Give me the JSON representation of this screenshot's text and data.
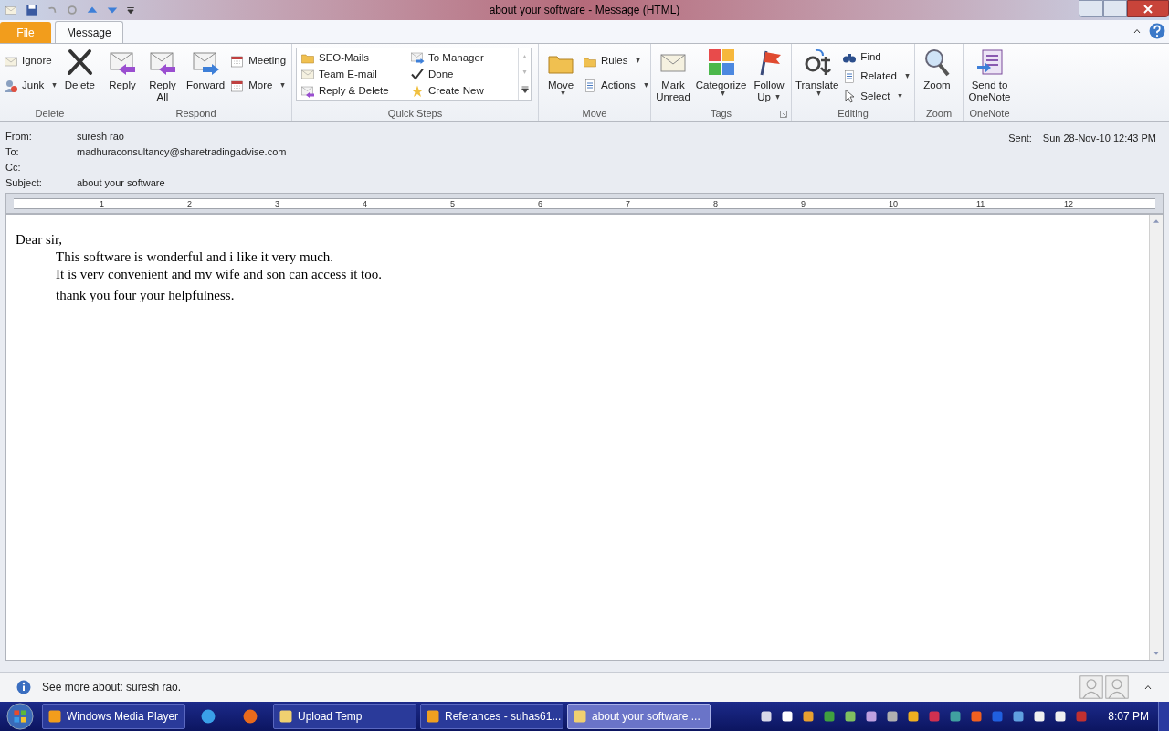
{
  "window": {
    "title": "about your software  -  Message (HTML)"
  },
  "tabs": [
    {
      "label": "File",
      "kind": "file",
      "selected": false
    },
    {
      "label": "Message",
      "kind": "tab",
      "selected": true
    }
  ],
  "ribbon": {
    "groups": [
      {
        "name": "Delete",
        "items": [
          {
            "kind": "small",
            "label": "Ignore",
            "dropdown": false
          },
          {
            "kind": "small",
            "label": "Junk",
            "dropdown": true
          },
          {
            "kind": "large",
            "label_lines": [
              "Delete"
            ],
            "dropdown": false
          }
        ]
      },
      {
        "name": "Respond",
        "items": [
          {
            "kind": "large",
            "label_lines": [
              "Reply"
            ],
            "dropdown": false
          },
          {
            "kind": "large",
            "label_lines": [
              "Reply",
              "All"
            ],
            "dropdown": false
          },
          {
            "kind": "large",
            "label_lines": [
              "Forward"
            ],
            "dropdown": false
          },
          {
            "kind": "small",
            "label": "Meeting",
            "dropdown": false
          },
          {
            "kind": "small",
            "label": "More",
            "dropdown": true
          }
        ]
      },
      {
        "name": "Quick Steps",
        "items": [
          {
            "kind": "gallery",
            "columns": [
              [
                "SEO-Mails",
                "Team E-mail",
                "Reply & Delete"
              ],
              [
                "To Manager",
                "Done",
                "Create New"
              ]
            ]
          }
        ]
      },
      {
        "name": "Move",
        "items": [
          {
            "kind": "large",
            "label_lines": [
              "Move"
            ],
            "dropdown": true
          },
          {
            "kind": "small",
            "label": "Rules",
            "dropdown": true
          },
          {
            "kind": "small",
            "label": "Actions",
            "dropdown": true
          }
        ]
      },
      {
        "name": "Tags",
        "launcher": true,
        "items": [
          {
            "kind": "large",
            "label_lines": [
              "Mark",
              "Unread"
            ],
            "dropdown": false
          },
          {
            "kind": "large",
            "label_lines": [
              "Categorize"
            ],
            "dropdown": true
          },
          {
            "kind": "large",
            "label_lines": [
              "Follow",
              "Up"
            ],
            "dropdown": true
          }
        ]
      },
      {
        "name": "Editing",
        "items": [
          {
            "kind": "large",
            "label_lines": [
              "Translate"
            ],
            "dropdown": true
          },
          {
            "kind": "small",
            "label": "Find",
            "dropdown": false
          },
          {
            "kind": "small",
            "label": "Related",
            "dropdown": true
          },
          {
            "kind": "small",
            "label": "Select",
            "dropdown": true
          }
        ]
      },
      {
        "name": "Zoom",
        "items": [
          {
            "kind": "large",
            "label_lines": [
              "Zoom"
            ],
            "dropdown": false
          }
        ]
      },
      {
        "name": "OneNote",
        "items": [
          {
            "kind": "large",
            "label_lines": [
              "Send to",
              "OneNote"
            ],
            "dropdown": false
          }
        ]
      }
    ]
  },
  "header": {
    "fields": [
      {
        "label": "From:",
        "value": "suresh rao"
      },
      {
        "label": "To:",
        "value": "madhuraconsultancy@sharetradingadvise.com"
      },
      {
        "label": "Cc:"
      },
      {
        "label": "Subject:",
        "value": "about your software"
      }
    ],
    "sent": {
      "label": "Sent:",
      "value": "Sun 28-Nov-10 12:43 PM"
    }
  },
  "ruler": {
    "numbers": [
      "1",
      "2",
      "3",
      "4",
      "5",
      "6",
      "7",
      "8",
      "9",
      "10",
      "11",
      "12"
    ]
  },
  "body": {
    "greeting": "Dear sir,",
    "indented_lines": [
      "This software is wonderful and i like it very much.",
      "It is verv convenient and mv wife and son can access it too.",
      "thank you four your helpfulness."
    ]
  },
  "people_pane": {
    "text": "See more about: suresh rao."
  },
  "taskbar": {
    "buttons": [
      {
        "label": "Windows Media Player",
        "kind": "window",
        "selected": false
      },
      {
        "kind": "pinned"
      },
      {
        "kind": "pinned"
      },
      {
        "label": "Upload Temp",
        "kind": "window",
        "selected": false
      },
      {
        "label": "Referances - suhas61...",
        "kind": "window",
        "selected": false
      },
      {
        "label": "about your software ...",
        "kind": "window",
        "selected": true
      }
    ],
    "clock": "8:07 PM"
  }
}
